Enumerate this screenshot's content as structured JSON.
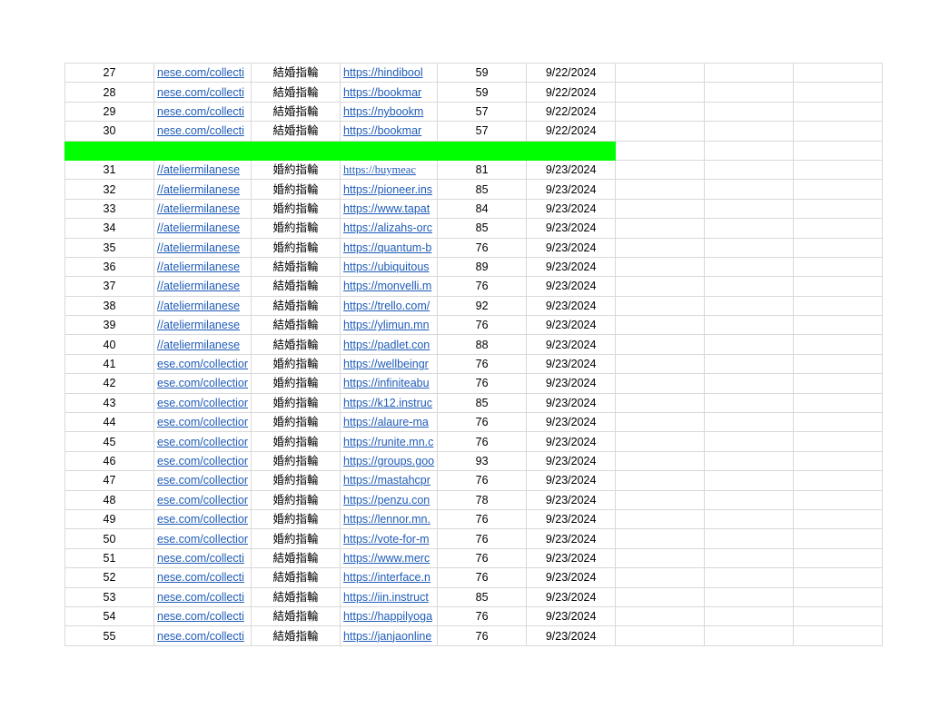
{
  "rows": [
    {
      "n": "27",
      "link": "nese.com/collecti",
      "kw": "結婚指輪",
      "url": "https://hindibool",
      "score": "59",
      "date": "9/22/2024"
    },
    {
      "n": "28",
      "link": "nese.com/collecti",
      "kw": "結婚指輪",
      "url": "https://bookmar",
      "score": "59",
      "date": "9/22/2024"
    },
    {
      "n": "29",
      "link": "nese.com/collecti",
      "kw": "結婚指輪",
      "url": "https://nybookm",
      "score": "57",
      "date": "9/22/2024"
    },
    {
      "n": "30",
      "link": "nese.com/collecti",
      "kw": "結婚指輪",
      "url": "https://bookmar",
      "score": "57",
      "date": "9/22/2024"
    },
    {
      "separator": true
    },
    {
      "n": "31",
      "link": "//ateliermilanese",
      "kw": "婚約指輪",
      "url": "https://buymeac",
      "score": "81",
      "date": "9/23/2024",
      "serif": true
    },
    {
      "n": "32",
      "link": "//ateliermilanese",
      "kw": "婚約指輪",
      "url": "https://pioneer.ins",
      "score": "85",
      "date": "9/23/2024"
    },
    {
      "n": "33",
      "link": "//ateliermilanese",
      "kw": "婚約指輪",
      "url": "https://www.tapat",
      "score": "84",
      "date": "9/23/2024"
    },
    {
      "n": "34",
      "link": "//ateliermilanese",
      "kw": "婚約指輪",
      "url": "https://alizahs-orc",
      "score": "85",
      "date": "9/23/2024"
    },
    {
      "n": "35",
      "link": "//ateliermilanese",
      "kw": "婚約指輪",
      "url": "https://quantum-b",
      "score": "76",
      "date": "9/23/2024"
    },
    {
      "n": "36",
      "link": "//ateliermilanese",
      "kw": "結婚指輪",
      "url": "https://ubiquitous",
      "score": "89",
      "date": "9/23/2024"
    },
    {
      "n": "37",
      "link": "//ateliermilanese",
      "kw": "結婚指輪",
      "url": "https://monvelli.m",
      "score": "76",
      "date": "9/23/2024"
    },
    {
      "n": "38",
      "link": "//ateliermilanese",
      "kw": "結婚指輪",
      "url": "https://trello.com/",
      "score": "92",
      "date": "9/23/2024"
    },
    {
      "n": "39",
      "link": "//ateliermilanese",
      "kw": "結婚指輪",
      "url": "https://ylimun.mn",
      "score": "76",
      "date": "9/23/2024"
    },
    {
      "n": "40",
      "link": "//ateliermilanese",
      "kw": "結婚指輪",
      "url": "https://padlet.con",
      "score": "88",
      "date": "9/23/2024"
    },
    {
      "n": "41",
      "link": "ese.com/collectior",
      "kw": "婚約指輪",
      "url": "https://wellbeingr",
      "score": "76",
      "date": "9/23/2024"
    },
    {
      "n": "42",
      "link": "ese.com/collectior",
      "kw": "婚約指輪",
      "url": "https://infiniteabu",
      "score": "76",
      "date": "9/23/2024"
    },
    {
      "n": "43",
      "link": "ese.com/collectior",
      "kw": "婚約指輪",
      "url": "https://k12.instruc",
      "score": "85",
      "date": "9/23/2024"
    },
    {
      "n": "44",
      "link": "ese.com/collectior",
      "kw": "婚約指輪",
      "url": "https://alaure-ma",
      "score": "76",
      "date": "9/23/2024"
    },
    {
      "n": "45",
      "link": "ese.com/collectior",
      "kw": "婚約指輪",
      "url": "https://runite.mn.c",
      "score": "76",
      "date": "9/23/2024"
    },
    {
      "n": "46",
      "link": "ese.com/collectior",
      "kw": "婚約指輪",
      "url": "https://groups.goo",
      "score": "93",
      "date": "9/23/2024"
    },
    {
      "n": "47",
      "link": "ese.com/collectior",
      "kw": "婚約指輪",
      "url": "https://mastahcpr",
      "score": "76",
      "date": "9/23/2024"
    },
    {
      "n": "48",
      "link": "ese.com/collectior",
      "kw": "婚約指輪",
      "url": "https://penzu.con",
      "score": "78",
      "date": "9/23/2024"
    },
    {
      "n": "49",
      "link": "ese.com/collectior",
      "kw": "婚約指輪",
      "url": "https://lennor.mn.",
      "score": "76",
      "date": "9/23/2024"
    },
    {
      "n": "50",
      "link": "ese.com/collectior",
      "kw": "婚約指輪",
      "url": "https://vote-for-m",
      "score": "76",
      "date": "9/23/2024"
    },
    {
      "n": "51",
      "link": "nese.com/collecti",
      "kw": "結婚指輪",
      "url": "https://www.merc",
      "score": "76",
      "date": "9/23/2024"
    },
    {
      "n": "52",
      "link": "nese.com/collecti",
      "kw": "結婚指輪",
      "url": "https://interface.n",
      "score": "76",
      "date": "9/23/2024"
    },
    {
      "n": "53",
      "link": "nese.com/collecti",
      "kw": "結婚指輪",
      "url": "https://iin.instruct",
      "score": "85",
      "date": "9/23/2024"
    },
    {
      "n": "54",
      "link": "nese.com/collecti",
      "kw": "結婚指輪",
      "url": "https://happilyoga",
      "score": "76",
      "date": "9/23/2024"
    },
    {
      "n": "55",
      "link": "nese.com/collecti",
      "kw": "結婚指輪",
      "url": "https://janjaonline",
      "score": "76",
      "date": "9/23/2024"
    }
  ],
  "colors": {
    "highlight": "#00ff00",
    "link": "#1f5cb8",
    "gridline": "#d9d9d9"
  }
}
